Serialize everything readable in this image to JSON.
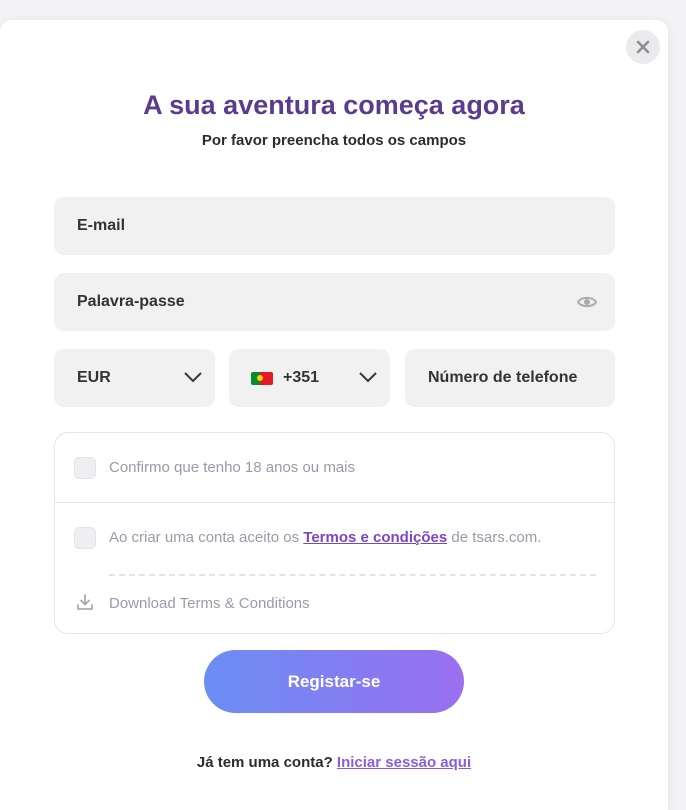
{
  "header": {
    "title": "A sua aventura começa agora",
    "subtitle": "Por favor preencha todos os campos"
  },
  "form": {
    "email_label": "E-mail",
    "password_label": "Palavra-passe",
    "currency_value": "EUR",
    "phone_prefix": "+351",
    "phone_label": "Número de telefone"
  },
  "terms": {
    "age_confirm": "Confirmo que tenho 18 anos ou mais",
    "accept_prefix": "Ao criar uma conta aceito os ",
    "terms_link": "Termos e condições",
    "accept_suffix": " de tsars.com.",
    "download_label": "Download Terms & Conditions"
  },
  "actions": {
    "register_label": "Registar-se"
  },
  "footer": {
    "login_prompt": "Já tem uma conta? ",
    "login_link": "Iniciar sessão aqui"
  },
  "icons": {
    "close": "close-icon",
    "eye": "eye-icon",
    "chevron": "chevron-down-icon",
    "flag": "portugal-flag-icon",
    "download": "download-icon"
  },
  "colors": {
    "title": "#5b3b8c",
    "accent": "#7b45c4",
    "button_start": "#6a8ef3",
    "button_end": "#9a6ff0"
  }
}
